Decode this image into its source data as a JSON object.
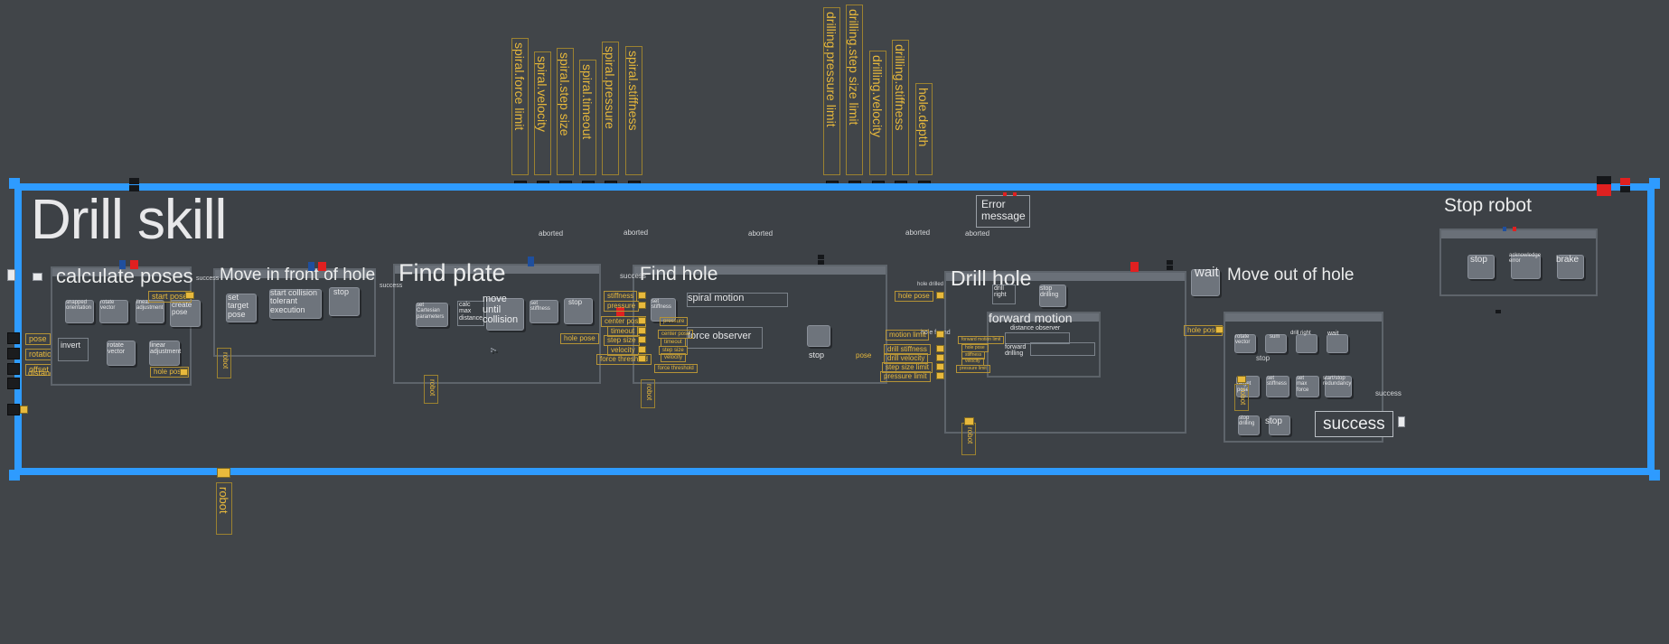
{
  "app": {
    "canvas_bg": "#414549",
    "selection_color": "#2e9bff",
    "data_port_color": "#e8b93c",
    "state_box_color": "#6e747c"
  },
  "root": {
    "title": "Drill skill",
    "inputs": [
      {
        "label": "pose"
      },
      {
        "label": "rotation"
      },
      {
        "label": "offset"
      },
      {
        "label": "distance"
      }
    ],
    "outputs": [
      {
        "label": "success"
      }
    ],
    "bottom_port": {
      "label": "robot"
    }
  },
  "global_params": {
    "group_spiral": [
      {
        "label": "spiral.force limit"
      },
      {
        "label": "spiral.velocity"
      },
      {
        "label": "spiral.step size"
      },
      {
        "label": "spiral.timeout"
      },
      {
        "label": "spiral.pressure"
      },
      {
        "label": "spiral.stiffness"
      }
    ],
    "group_drilling": [
      {
        "label": "drilling.pressure limit"
      },
      {
        "label": "drilling.step size limit"
      },
      {
        "label": "drilling.velocity"
      },
      {
        "label": "drilling.stiffness"
      },
      {
        "label": "hole.depth"
      }
    ]
  },
  "states": {
    "calculate_poses": {
      "title": "calculate poses",
      "children": [
        {
          "label": "snapped\norientation"
        },
        {
          "label": "rotate\nvector"
        },
        {
          "label": "linear\nadjustment"
        },
        {
          "label": "create\npose"
        },
        {
          "label": "invert"
        },
        {
          "label": "rotate\nvector"
        },
        {
          "label": "linear\nadjustment"
        }
      ],
      "ports": [
        {
          "label": "start pose"
        },
        {
          "label": "hole pose"
        }
      ]
    },
    "move_in_front_of_hole": {
      "title": "Move in front of hole",
      "children": [
        {
          "label": "set\ntarget\npose"
        },
        {
          "label": "start collision\ntolerant\nexecution"
        },
        {
          "label": "stop"
        }
      ],
      "ports": [
        {
          "label": "robot"
        }
      ]
    },
    "find_plate": {
      "title": "Find plate",
      "children": [
        {
          "label": "set\nCartesian\nparameters"
        },
        {
          "label": "calc\nmax\ndistance"
        },
        {
          "label": "move\nuntil\ncollision"
        },
        {
          "label": "set\nstiffness"
        },
        {
          "label": "stop"
        }
      ],
      "ports": [
        {
          "label": "hole pose"
        },
        {
          "label": "robot"
        }
      ]
    },
    "find_hole": {
      "title": "Find hole",
      "children": [
        {
          "label": "set\nstiffness"
        },
        {
          "label": "force observer"
        },
        {
          "label": "spiral motion"
        },
        {
          "label": "stop"
        }
      ],
      "ports": [
        {
          "label": "stiffness"
        },
        {
          "label": "pressure"
        },
        {
          "label": "center pose"
        },
        {
          "label": "timeout"
        },
        {
          "label": "step size"
        },
        {
          "label": "velocity"
        },
        {
          "label": "force threshold"
        },
        {
          "label": "pose"
        },
        {
          "label": "robot"
        }
      ],
      "inner_ports": [
        {
          "label": "pressure"
        },
        {
          "label": "center pose"
        },
        {
          "label": "timeout"
        },
        {
          "label": "step size"
        },
        {
          "label": "velocity"
        },
        {
          "label": "force threshold"
        }
      ]
    },
    "drill_hole": {
      "title": "Drill hole",
      "children": [
        {
          "label": "drill\nright"
        },
        {
          "label": "stop\ndrilling"
        },
        {
          "label": "forward motion"
        },
        {
          "label": "distance observer"
        },
        {
          "label": "forward\ndrilling"
        }
      ],
      "ports": [
        {
          "label": "hole pose"
        },
        {
          "label": "motion limit"
        },
        {
          "label": "drill stiffness"
        },
        {
          "label": "drill velocity"
        },
        {
          "label": "step size limit"
        },
        {
          "label": "pressure limit"
        },
        {
          "label": "robot"
        }
      ],
      "inner_ports": [
        {
          "label": "forward motion limit"
        },
        {
          "label": "hole pose"
        },
        {
          "label": "stiffness"
        },
        {
          "label": "velocity"
        },
        {
          "label": "pressure limit"
        }
      ]
    },
    "stop_robot": {
      "title": "Stop robot",
      "children": [
        {
          "label": "stop"
        },
        {
          "label": "acknowledge\nerror"
        },
        {
          "label": "brake"
        }
      ]
    },
    "move_out_of_hole": {
      "title": "Move out of hole",
      "children": [
        {
          "label": "rotate\nvector"
        },
        {
          "label": "sum"
        },
        {
          "label": "drill right"
        },
        {
          "label": "wait"
        },
        {
          "label": "set\ntarget\npose"
        },
        {
          "label": "set\nstiffness"
        },
        {
          "label": "set\nmax\nforce"
        },
        {
          "label": "start/stop\nredundancy"
        },
        {
          "label": "stop\ndrilling"
        },
        {
          "label": "stop"
        }
      ],
      "ports": [
        {
          "label": "hole pose"
        },
        {
          "label": "robot"
        }
      ]
    },
    "wait": {
      "title": "wait"
    },
    "error_message": {
      "title": "Error\nmessage"
    }
  },
  "transitions": [
    {
      "label": "aborted"
    },
    {
      "label": "aborted"
    },
    {
      "label": "aborted"
    },
    {
      "label": "aborted"
    },
    {
      "label": "aborted"
    },
    {
      "label": "success"
    },
    {
      "label": "success"
    },
    {
      "label": "success"
    },
    {
      "label": "hole found"
    },
    {
      "label": "hole drilled"
    },
    {
      "label": "stop"
    },
    {
      "label": "success"
    }
  ],
  "outputs": {
    "success_label": "success"
  }
}
